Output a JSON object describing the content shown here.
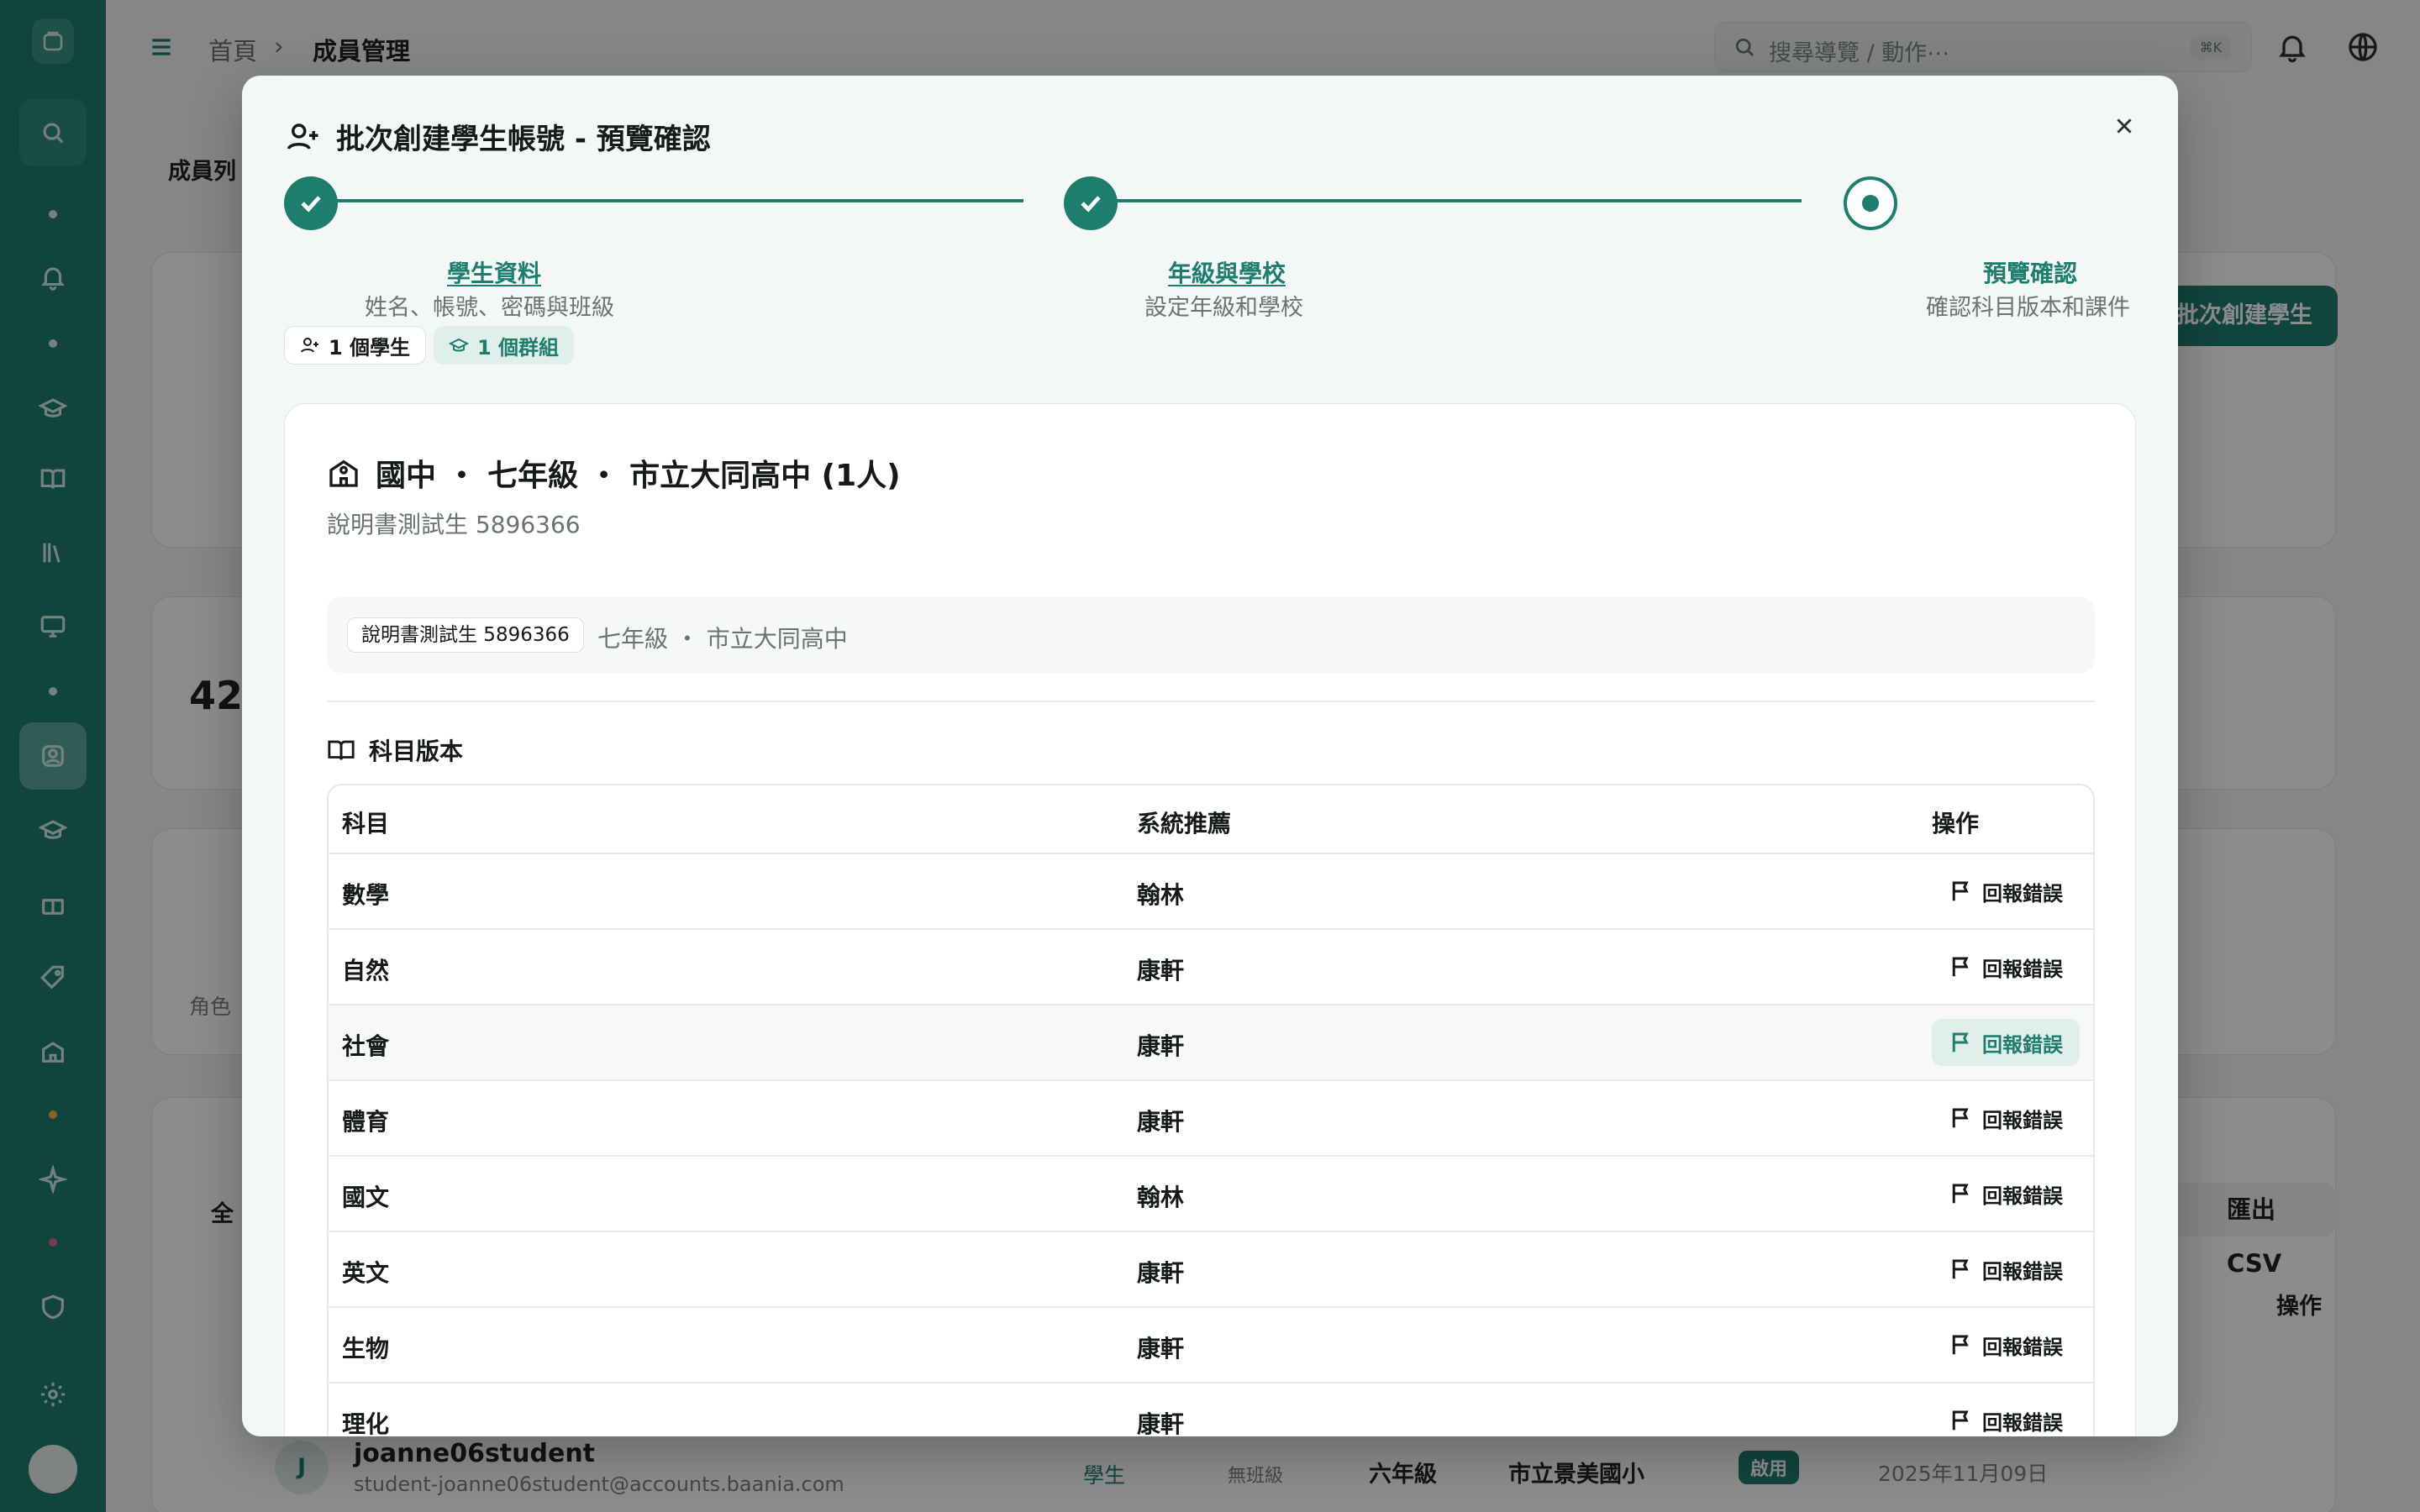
{
  "app": {
    "breadcrumb": [
      "首頁",
      "成員管理"
    ],
    "search_placeholder": "搜尋導覽 / 動作⋯",
    "search_shortcut": "⌘K",
    "bg_section": "成員列",
    "bg_stat": "42",
    "bg_role_label": "角色",
    "bg_filter_label": "全",
    "bg_action_header": "操作",
    "batch_create_button": "批次創建學生",
    "export_csv_button": "匯出 CSV",
    "bg_row": {
      "avatar": "J",
      "username": "joanne06student",
      "email": "student-joanne06student@accounts.baania.com",
      "role": "學生",
      "class": "無班級",
      "grade": "六年級",
      "school": "市立景美國小",
      "status": "啟用",
      "date": "2025年11月09日"
    }
  },
  "modal": {
    "title": "批次創建學生帳號 - 預覽確認",
    "steps": [
      {
        "label": "學生資料",
        "desc": "姓名、帳號、密碼與班級",
        "state": "done"
      },
      {
        "label": "年級與學校",
        "desc": "設定年級和學校",
        "state": "done"
      },
      {
        "label": "預覽確認",
        "desc": "確認科目版本和課件",
        "state": "current"
      }
    ],
    "summary": {
      "students": "1 個學生",
      "groups": "1 個群組"
    },
    "group": {
      "title": "國中 ・ 七年級 ・ 市立大同高中 (1人)",
      "subtitle": "說明書測試生 5896366",
      "student_name": "說明書測試生 5896366",
      "student_meta": "七年級 ・ 市立大同高中"
    },
    "subjects_section_title": "科目版本",
    "table": {
      "headers": [
        "科目",
        "系統推薦",
        "操作"
      ],
      "rows": [
        {
          "subject": "數學",
          "recommend": "翰林",
          "action": "回報錯誤"
        },
        {
          "subject": "自然",
          "recommend": "康軒",
          "action": "回報錯誤"
        },
        {
          "subject": "社會",
          "recommend": "康軒",
          "action": "回報錯誤"
        },
        {
          "subject": "體育",
          "recommend": "康軒",
          "action": "回報錯誤"
        },
        {
          "subject": "國文",
          "recommend": "翰林",
          "action": "回報錯誤"
        },
        {
          "subject": "英文",
          "recommend": "康軒",
          "action": "回報錯誤"
        },
        {
          "subject": "生物",
          "recommend": "康軒",
          "action": "回報錯誤"
        },
        {
          "subject": "理化",
          "recommend": "康軒",
          "action": "回報錯誤"
        }
      ]
    }
  },
  "colors": {
    "brand": "#1f7d70",
    "brand_light": "#e1efeb",
    "overlay": "rgba(0,0,0,0.45)"
  }
}
